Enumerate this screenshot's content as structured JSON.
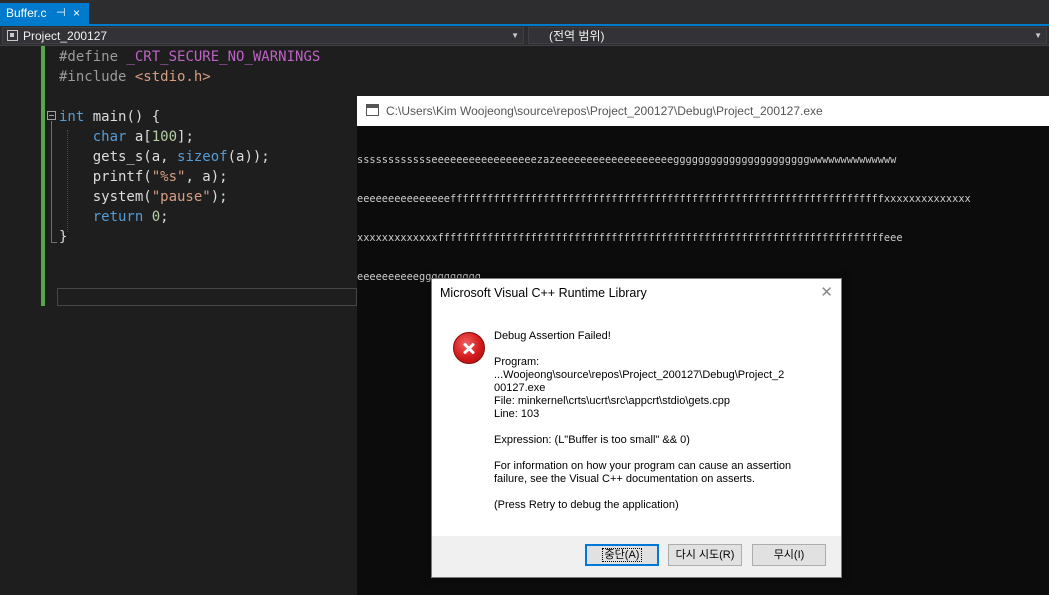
{
  "tab": {
    "name": "Buffer.c",
    "pin": "⊣",
    "close": "×"
  },
  "nav": {
    "project": "Project_200127",
    "scope": "(전역 범위)"
  },
  "code": {
    "l1_a": "#define ",
    "l1_b": "_CRT_SECURE_NO_WARNINGS",
    "l2_a": "#include ",
    "l2_b": "<stdio.h>",
    "l4_a": "int",
    "l4_b": " main() {",
    "l5_a": "    ",
    "l5_b": "char",
    "l5_c": " a[",
    "l5_d": "100",
    "l5_e": "];",
    "l6_a": "    gets_s(a, ",
    "l6_b": "sizeof",
    "l6_c": "(a));",
    "l7_a": "    printf(",
    "l7_b": "\"%s\"",
    "l7_c": ", a);",
    "l8_a": "    system(",
    "l8_b": "\"pause\"",
    "l8_c": ");",
    "l9_a": "    ",
    "l9_b": "return",
    "l9_c": " ",
    "l9_d": "0",
    "l9_e": ";",
    "l10": "}"
  },
  "console": {
    "title": "C:\\Users\\Kim Woojeong\\source\\repos\\Project_200127\\Debug\\Project_200127.exe",
    "lines": [
      "sssssssssssseeeeeeeeeeeeeeeeezazeeeeeeeeeeeeeeeeeeeggggggggggggggggggggggwwwwwwwwwwwwww",
      "eeeeeeeeeeeeeeeffffffffffffffffffffffffffffffffffffffffffffffffffffffffffffffffffffffxxxxxxxxxxxxxx",
      "xxxxxxxxxxxxxffffffffffffffffffffffffffffffffffffffffffffffffffffffffffffffffffffffffeee",
      "eeeeeeeeeegggggggggg"
    ]
  },
  "dialog": {
    "title": "Microsoft Visual C++ Runtime Library",
    "close": "✕",
    "heading": "Debug Assertion Failed!",
    "program_label": "Program:",
    "program_line1": "...Woojeong\\source\\repos\\Project_200127\\Debug\\Project_2",
    "program_line2": "00127.exe",
    "file": "File: minkernel\\crts\\ucrt\\src\\appcrt\\stdio\\gets.cpp",
    "line": "Line: 103",
    "expression": "Expression: (L\"Buffer is too small\" && 0)",
    "info_line1": "For information on how your program can cause an assertion",
    "info_line2": "failure, see the Visual C++ documentation on asserts.",
    "retry_hint": "(Press Retry to debug the application)",
    "buttons": {
      "abort": "중단(A)",
      "retry": "다시 시도(R)",
      "ignore": "무시(I)"
    }
  }
}
